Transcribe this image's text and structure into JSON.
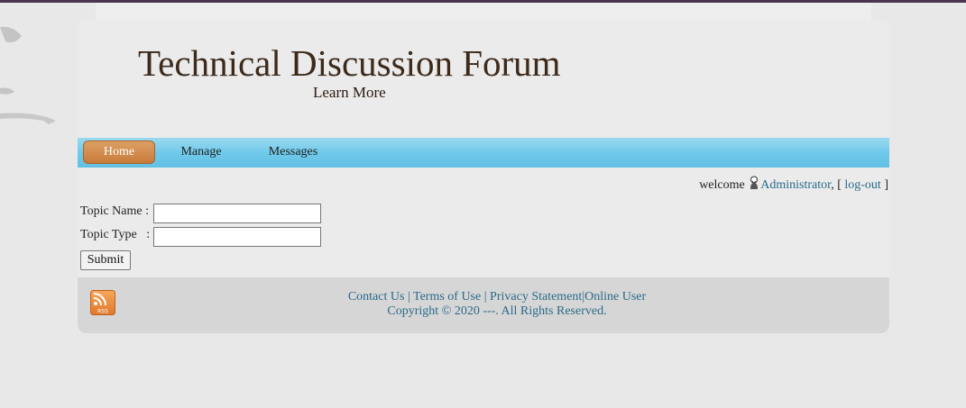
{
  "header": {
    "title": "Technical Discussion Forum",
    "subtitle": "Learn More"
  },
  "nav": {
    "items": [
      {
        "label": "Home",
        "active": true
      },
      {
        "label": "Manage"
      },
      {
        "label": "Messages"
      }
    ],
    "accent_color": "#c97b3a",
    "bar_color": "#6fc9ea"
  },
  "welcome": {
    "prefix": "welcome",
    "user_icon": "user-icon",
    "username": "Administrator",
    "separator": ", [",
    "logout": "log-out",
    "suffix": "]"
  },
  "form": {
    "topic_name_label": "Topic Name :",
    "topic_type_label": "Topic Type   :",
    "topic_name_value": "",
    "topic_type_value": "",
    "submit_label": "Submit"
  },
  "footer": {
    "rss_icon": "rss-icon",
    "links": {
      "contact": "Contact Us",
      "sep1": " | ",
      "terms": "Terms of Use",
      "sep2": " | ",
      "privacy": "Privacy Statement",
      "sep3": "|",
      "online": "Online User"
    },
    "copyright": "Copyright © 2020 ---. All Rights Reserved.",
    "link_color": "#2a6a8a"
  }
}
